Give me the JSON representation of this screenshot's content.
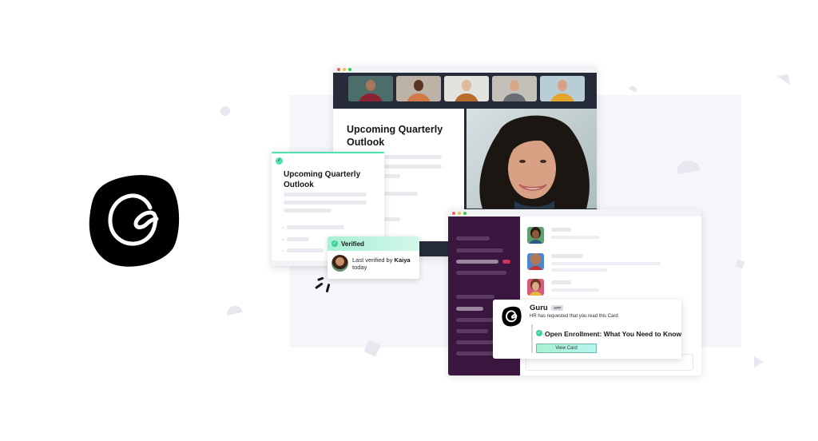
{
  "brand": {
    "logo_icon": "guru-logo-icon",
    "accent_color": "#4de0b0",
    "dark_color": "#15161a"
  },
  "video_window": {
    "participants": [
      {
        "name": "participant-1",
        "skin": "#a9765a",
        "shirt": "#8a2434",
        "bg": "#4c6e6a"
      },
      {
        "name": "participant-2",
        "skin": "#5a3421",
        "shirt": "#d07a48",
        "bg": "#bcb3a6"
      },
      {
        "name": "participant-3",
        "skin": "#e1b899",
        "shirt": "#b96c2c",
        "bg": "#e2e2de"
      },
      {
        "name": "participant-4",
        "skin": "#d8a788",
        "shirt": "#6a6e74",
        "bg": "#c3c0b9"
      },
      {
        "name": "participant-5",
        "skin": "#d9a287",
        "shirt": "#e2a42b",
        "bg": "#b9cdd5"
      }
    ],
    "doc_title": "Upcoming Quarterly Outlook",
    "speaker": "featured-speaker"
  },
  "card": {
    "title": "Upcoming Quarterly Outlook",
    "status_icon": "check-icon"
  },
  "verified": {
    "label": "Verified",
    "prefix": "Last verified by ",
    "verifier": "Kaiya",
    "when": "today"
  },
  "chat": {
    "sidebar_colors": {
      "bg": "#3b1740",
      "badge": "#c9385c"
    },
    "messages": [
      {
        "avatar_bg": "#5fa06e",
        "skin": "#8a5a3e",
        "hair": "#2a1a12",
        "shirt": "#2c5b8a"
      },
      {
        "avatar_bg": "#4c86cf",
        "skin": "#b07a58",
        "hair": "#b07a58",
        "shirt": "#c73434"
      },
      {
        "avatar_bg": "#d95b7c",
        "skin": "#e0aa8a",
        "hair": "#6a3a22",
        "shirt": "#e9b63a"
      }
    ]
  },
  "notification": {
    "app_name": "Guru",
    "app_badge": "APP",
    "subtitle": "HR has requested that you read this Card",
    "card_title": "Open Enrollment: What You Need to Know",
    "button_label": "View Card"
  }
}
